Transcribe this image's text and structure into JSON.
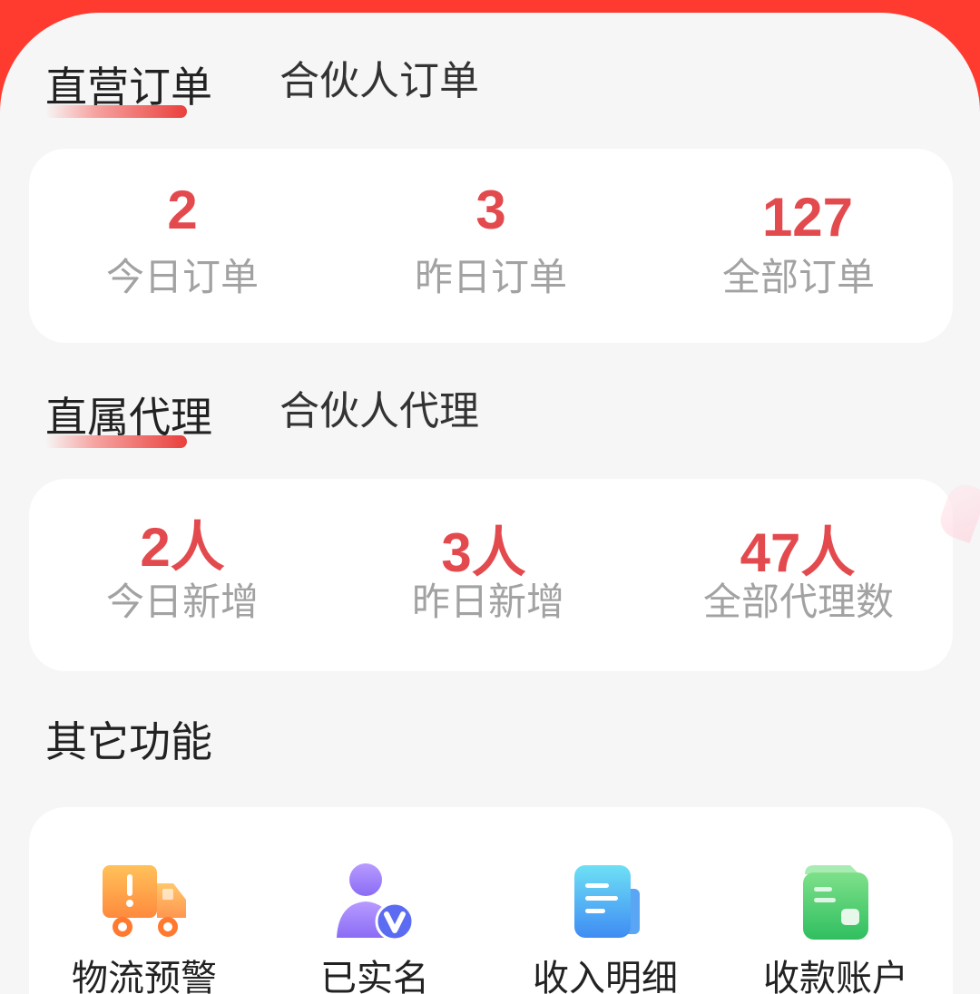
{
  "order_tabs": {
    "active": "直营订单",
    "inactive": "合伙人订单"
  },
  "order_stats": [
    {
      "value": "2",
      "label": "今日订单"
    },
    {
      "value": "3",
      "label": "昨日订单"
    },
    {
      "value": "127",
      "label": "全部订单"
    }
  ],
  "agent_tabs": {
    "active": "直属代理",
    "inactive": "合伙人代理"
  },
  "agent_stats": [
    {
      "value": "2人",
      "label": "今日新增"
    },
    {
      "value": "3人",
      "label": "昨日新增"
    },
    {
      "value": "47人",
      "label": "全部代理数"
    }
  ],
  "other_functions": {
    "title": "其它功能",
    "items": [
      {
        "label": "物流预警",
        "icon": "truck-warning-icon"
      },
      {
        "label": "已实名",
        "icon": "user-verified-icon"
      },
      {
        "label": "收入明细",
        "icon": "income-detail-icon"
      },
      {
        "label": "收款账户",
        "icon": "wallet-icon"
      }
    ]
  },
  "colors": {
    "accent": "#e34a4e",
    "header": "#ff3b30",
    "background": "#f6f6f6"
  }
}
